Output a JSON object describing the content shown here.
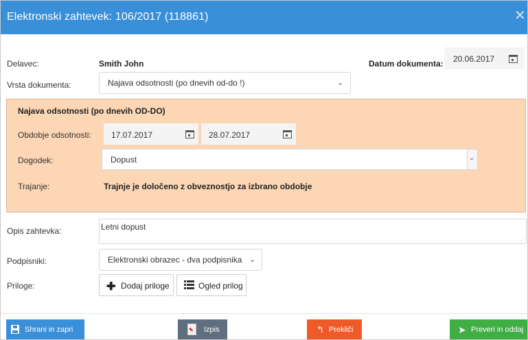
{
  "dialog": {
    "title": "Elektronski zahtevek: 106/2017 (118861)"
  },
  "worker": {
    "label": "Delavec:",
    "value": "Smith John"
  },
  "doc_date": {
    "label": "Datum dokumenta:",
    "value": "20.06.2017"
  },
  "doc_type": {
    "label": "Vrsta dokumenta:",
    "selected": "Najava odsotnosti (po dnevih od-do !)"
  },
  "panel": {
    "heading": "Najava odsotnosti (po dnevih OD-DO)",
    "period_label": "Obdobje odsotnosti:",
    "date_from": "17.07.2017",
    "date_to": "28.07.2017",
    "event_label": "Dogodek:",
    "event_selected": "Dopust",
    "duration_label": "Trajanje:",
    "duration_value": "Trajnje je določeno z obveznostjo za izbrano obdobje"
  },
  "description": {
    "label": "Opis zahtevka:",
    "value": "Letni dopust"
  },
  "signers": {
    "label": "Podpisniki:",
    "selected": "Elektronski obrazec - dva podpisnika"
  },
  "attachments": {
    "label": "Priloge:",
    "add_label": "Dodaj priloge",
    "view_label": "Ogled prilog"
  },
  "footer": {
    "save_label": "Shrani in zapri",
    "print_label": "Izpis",
    "cancel_label": "Prekliči",
    "submit_label": "Preveri in oddaj"
  },
  "colors": {
    "title_bar": "#3a8fd9",
    "panel_bg": "#fcd6b5",
    "save_btn": "#3a8fd9",
    "print_btn": "#5f6f7f",
    "cancel_btn": "#f05a28",
    "submit_btn": "#3fae45"
  },
  "icons": {
    "close": "close-icon",
    "calendar": "calendar-icon",
    "chevron": "chevron-down-icon",
    "save": "save-icon",
    "pdf": "pdf-icon",
    "cancel": "undo-arrow-icon",
    "submit": "paper-plane-icon",
    "plus": "plus-icon",
    "list": "list-icon"
  }
}
